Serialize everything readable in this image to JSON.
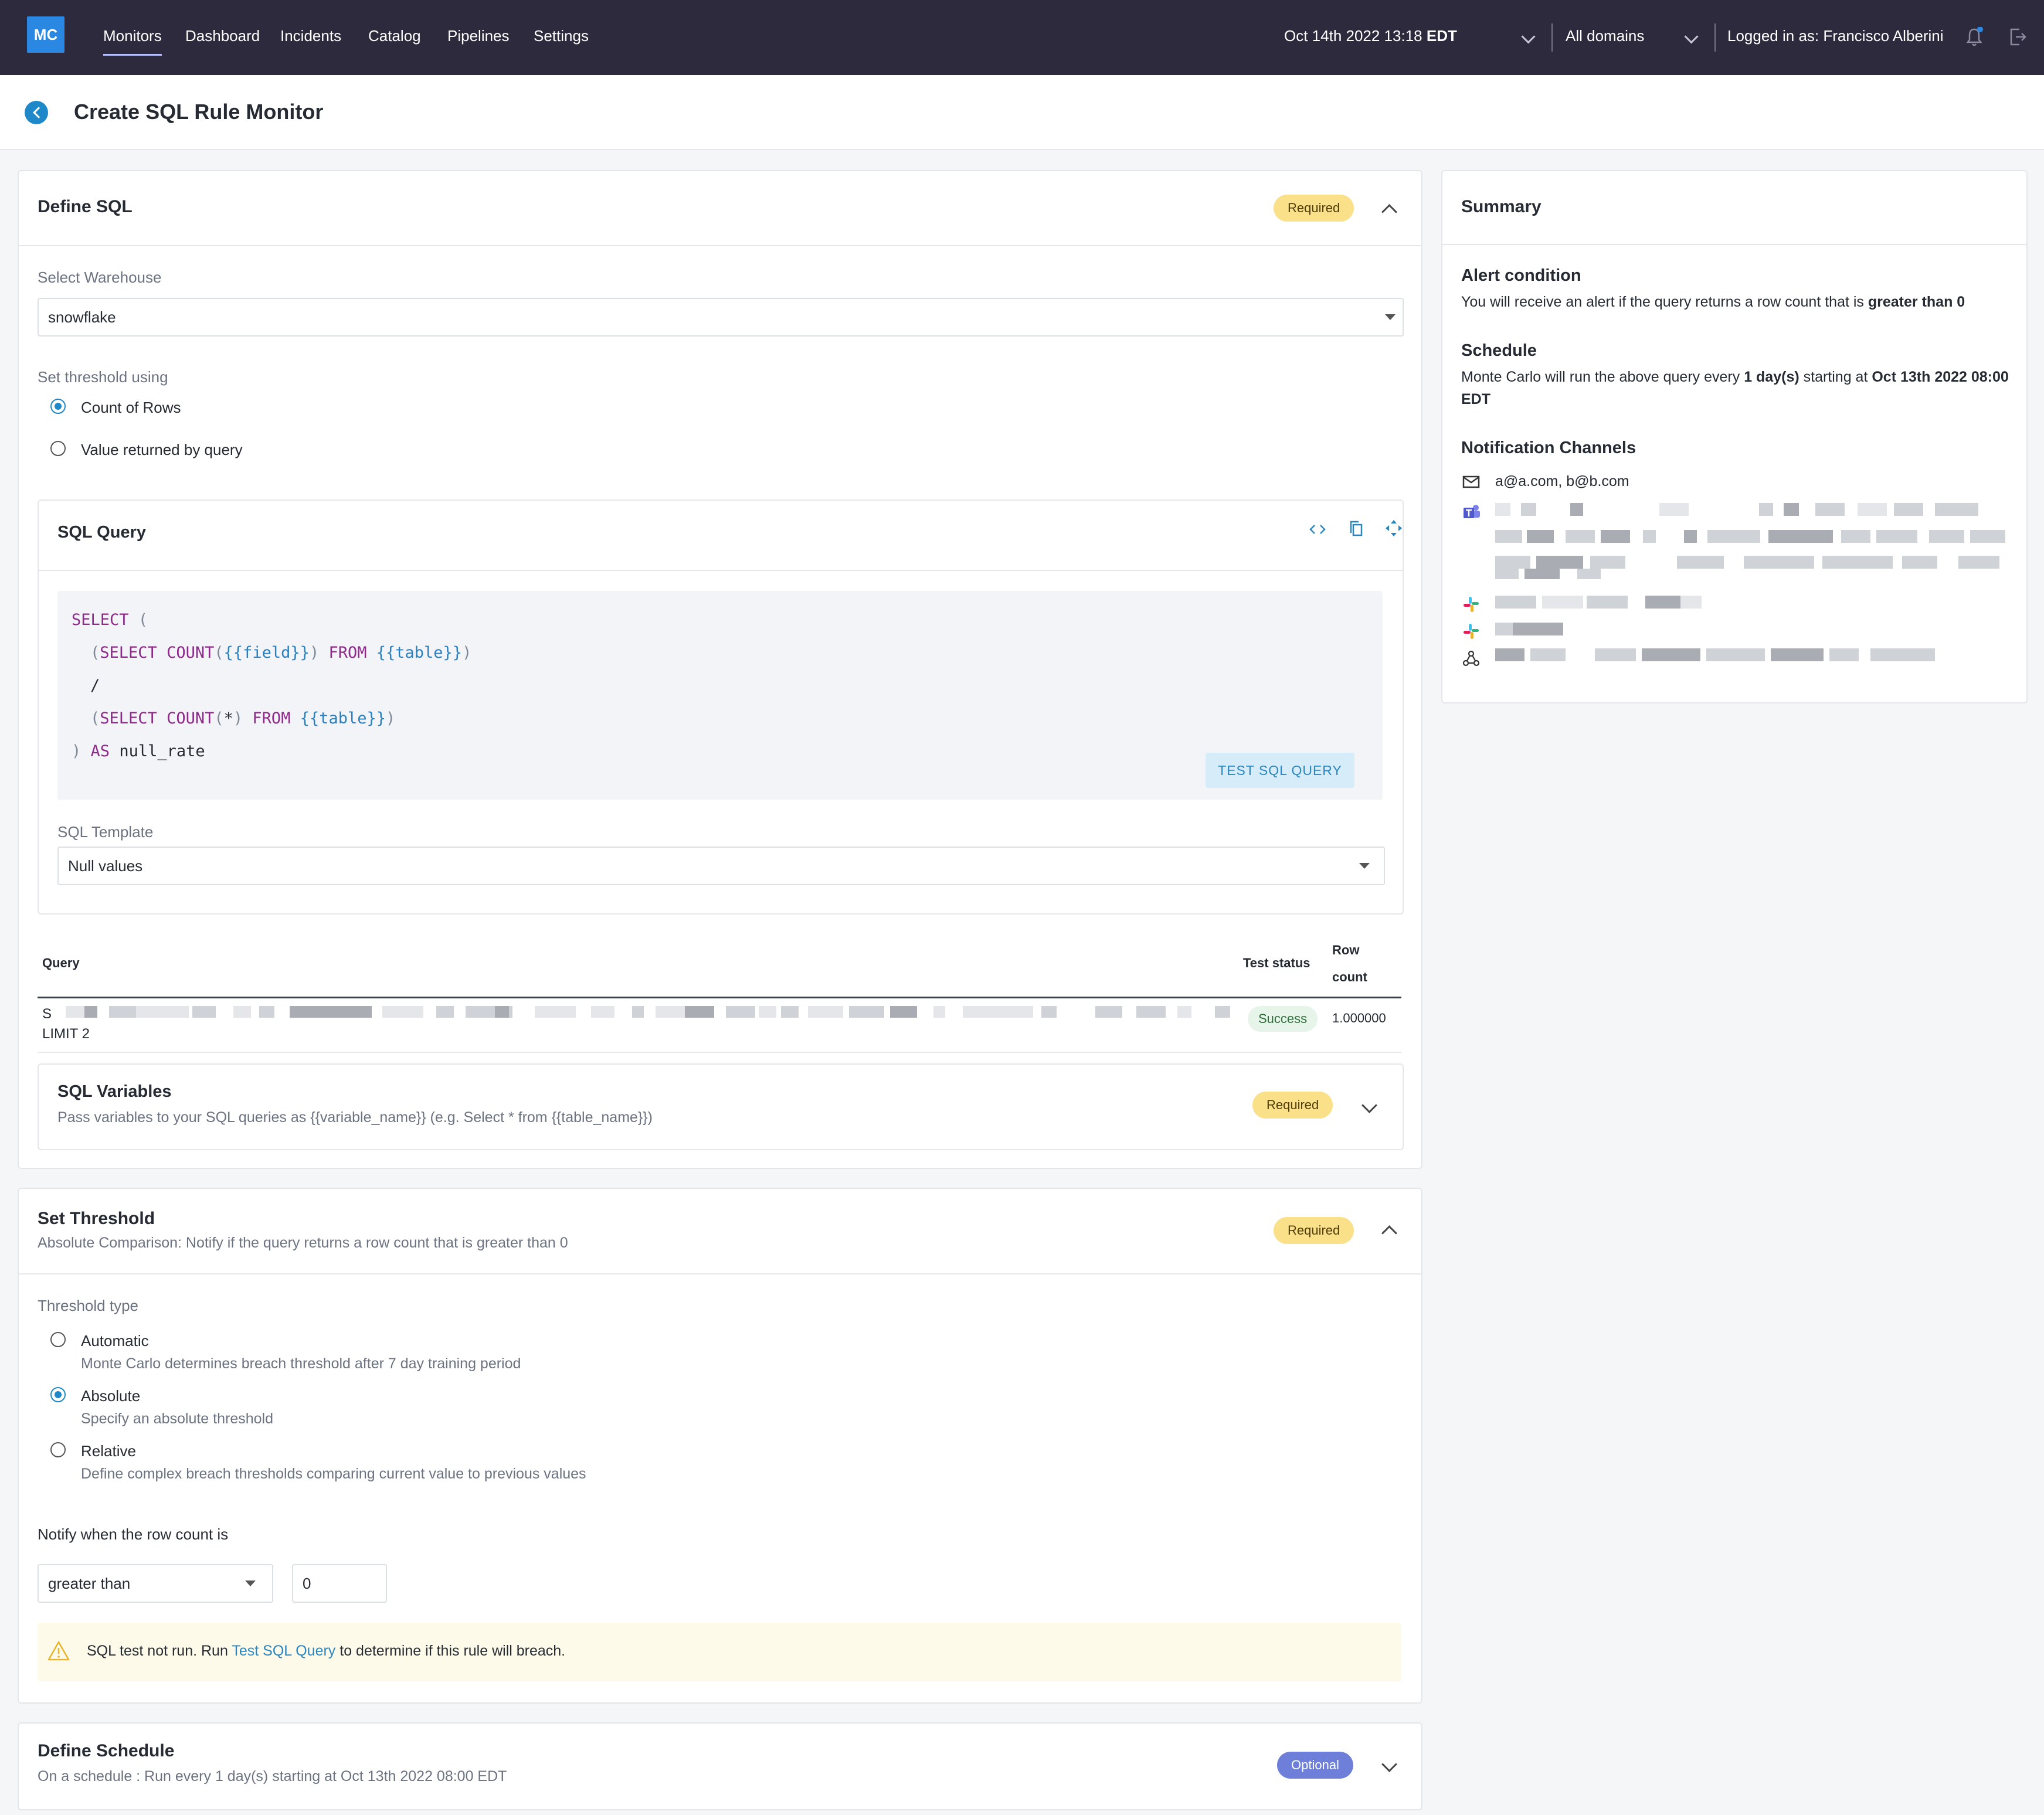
{
  "nav": {
    "logo": "MC",
    "items": [
      "Monitors",
      "Dashboard",
      "Incidents",
      "Catalog",
      "Pipelines",
      "Settings"
    ],
    "active": "Monitors",
    "date": "Oct 14th 2022 13:18",
    "date_tz": "EDT",
    "domains": "All domains",
    "logged_in": "Logged in as: Francisco Alberini"
  },
  "page": {
    "title": "Create SQL Rule Monitor"
  },
  "define_sql": {
    "title": "Define SQL",
    "badge": "Required",
    "warehouse_label": "Select Warehouse",
    "warehouse_value": "snowflake",
    "threshold_label": "Set threshold using",
    "options": [
      "Count of Rows",
      "Value returned by query"
    ],
    "selected_option": "Count of Rows",
    "sql_query": {
      "title": "SQL Query",
      "code": {
        "l1_kw": "SELECT",
        "l1_br": "(",
        "l2_br1": "(",
        "l2_kw1": "SELECT",
        "l2_kw2": "COUNT",
        "l2_br2": "(",
        "l2_tpl": "{{field}}",
        "l2_br3": ")",
        "l2_kw3": "FROM",
        "l2_tpl2": "{{table}}",
        "l2_br4": ")",
        "l3": "/",
        "l4_br1": "(",
        "l4_kw1": "SELECT",
        "l4_kw2": "COUNT",
        "l4_br2": "(",
        "l4_star": "*",
        "l4_br3": ")",
        "l4_kw3": "FROM",
        "l4_tpl": "{{table}}",
        "l4_br4": ")",
        "l5_br": ")",
        "l5_kw": "AS",
        "l5_plain": "null_rate"
      },
      "test_button": "TEST SQL QUERY",
      "template_label": "SQL Template",
      "template_value": "Null values"
    },
    "results_table": {
      "headers": [
        "Query",
        "Test status",
        "Row",
        "count"
      ],
      "row": {
        "query_tail": "LIMIT 2",
        "query_head": "S",
        "status": "Success",
        "row_count": "1.000000"
      }
    },
    "variables": {
      "title": "SQL Variables",
      "desc": "Pass variables to your SQL queries as {{variable_name}} (e.g. Select * from {{table_name}})",
      "badge": "Required"
    }
  },
  "set_threshold": {
    "title": "Set Threshold",
    "subtitle": "Absolute Comparison: Notify if the query returns a row count that is greater than 0",
    "badge": "Required",
    "type_label": "Threshold type",
    "types": [
      {
        "name": "Automatic",
        "desc": "Monte Carlo determines breach threshold after 7 day training period"
      },
      {
        "name": "Absolute",
        "desc": "Specify an absolute threshold"
      },
      {
        "name": "Relative",
        "desc": "Define complex breach thresholds comparing current value to previous values"
      }
    ],
    "selected_type": "Absolute",
    "notify_label": "Notify when the row count is",
    "comparator": "greater than",
    "value": "0",
    "warning_pre": "SQL test not run. Run ",
    "warning_link": "Test SQL Query",
    "warning_post": " to determine if this rule will breach."
  },
  "define_schedule": {
    "title": "Define Schedule",
    "subtitle": "On a schedule : Run every 1 day(s) starting at Oct 13th 2022 08:00 EDT",
    "badge": "Optional"
  },
  "summary": {
    "title": "Summary",
    "alert_h": "Alert condition",
    "alert_pre": "You will receive an alert if the query returns a row count that is ",
    "alert_bold": "greater than 0",
    "schedule_h": "Schedule",
    "schedule_pre": "Monte Carlo will run the above query every ",
    "schedule_bold1": "1 day(s)",
    "schedule_mid": " starting at ",
    "schedule_bold2": "Oct 13th 2022 08:00 EDT",
    "channels_h": "Notification Channels",
    "email": "a@a.com, b@b.com"
  },
  "icons": {
    "back": "back-arrow-icon",
    "bell": "bell-icon",
    "logout": "logout-icon",
    "code": "code-icon",
    "copy": "copy-icon",
    "expand": "expand-icon",
    "warning": "warning-triangle-icon",
    "email": "mail-icon",
    "teams": "teams-icon",
    "slack": "slack-icon",
    "webhook": "webhook-icon"
  },
  "colors": {
    "nav_bg": "#2d2a3e",
    "accent": "#1e88c8",
    "required": "#fbe08a",
    "optional": "#6d7fd8",
    "success": "#e6f4ea"
  }
}
